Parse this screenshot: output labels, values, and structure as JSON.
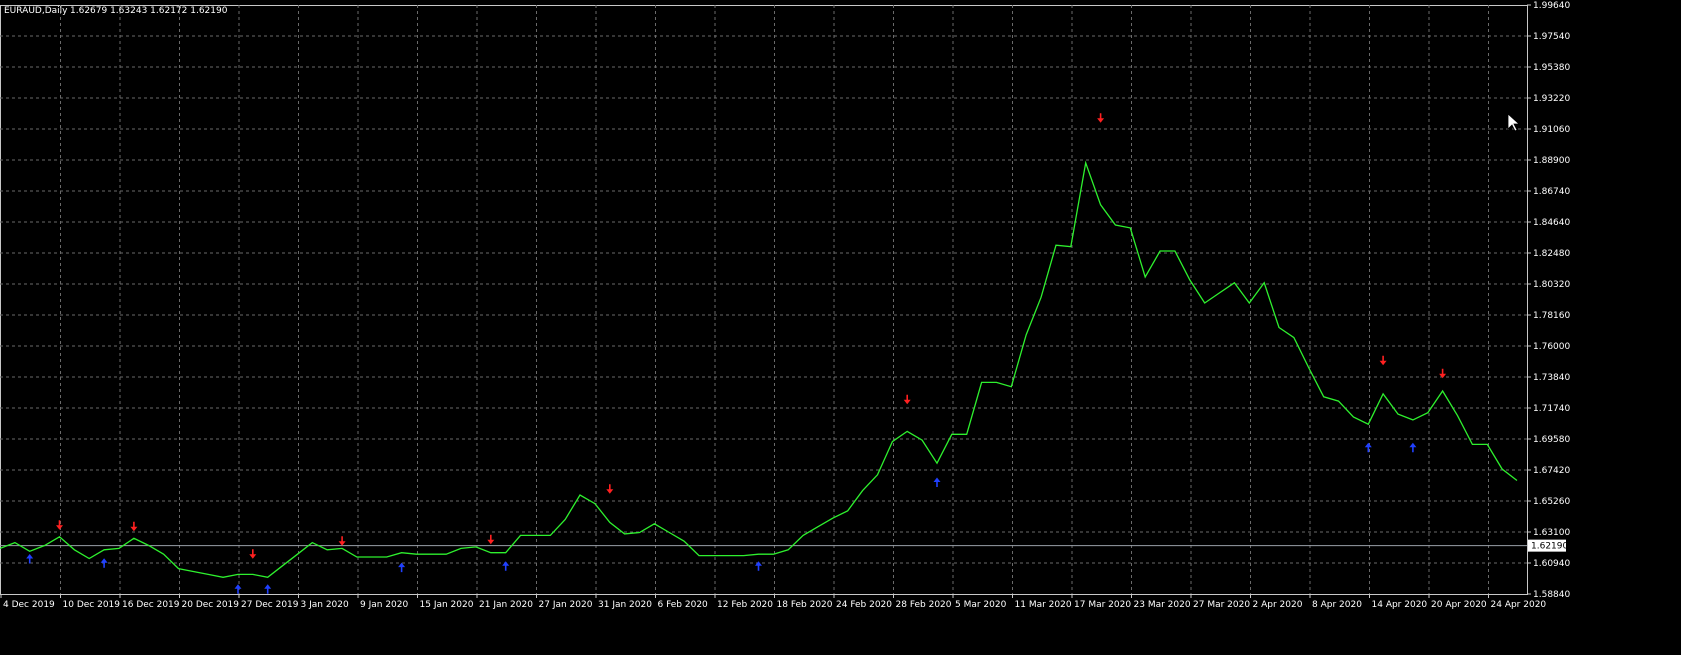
{
  "header": {
    "symbol": "EURAUD,Daily",
    "ohlc": "1.62679 1.63243 1.62172 1.62190"
  },
  "current_price_label": "1.62190",
  "colors": {
    "background": "#000000",
    "grid": "#6a6a6a",
    "line": "#2ef02e",
    "down_arrow": "#ff2020",
    "up_arrow": "#2040ff",
    "axis_text": "#ffffff",
    "price_line": "#9aa0a8"
  },
  "cursor_icon": "mouse-pointer-icon",
  "chart_data": {
    "type": "line",
    "title": "",
    "xlabel": "",
    "ylabel": "",
    "grid": true,
    "ylim": [
      1.5884,
      1.9964
    ],
    "y_ticks": [
      "1.99640",
      "1.97540",
      "1.95380",
      "1.93220",
      "1.91060",
      "1.88900",
      "1.86740",
      "1.84640",
      "1.82480",
      "1.80320",
      "1.78160",
      "1.76000",
      "1.73840",
      "1.71740",
      "1.69580",
      "1.67420",
      "1.65260",
      "1.63100",
      "1.60940",
      "1.58840"
    ],
    "x_ticks": [
      "4 Dec 2019",
      "10 Dec 2019",
      "16 Dec 2019",
      "20 Dec 2019",
      "27 Dec 2019",
      "3 Jan 2020",
      "9 Jan 2020",
      "15 Jan 2020",
      "21 Jan 2020",
      "27 Jan 2020",
      "31 Jan 2020",
      "6 Feb 2020",
      "12 Feb 2020",
      "18 Feb 2020",
      "24 Feb 2020",
      "28 Feb 2020",
      "5 Mar 2020",
      "11 Mar 2020",
      "17 Mar 2020",
      "23 Mar 2020",
      "27 Mar 2020",
      "2 Apr 2020",
      "8 Apr 2020",
      "14 Apr 2020",
      "20 Apr 2020",
      "24 Apr 2020"
    ],
    "current_price": 1.6219,
    "series": [
      {
        "values": [
          1.62,
          1.624,
          1.618,
          1.622,
          1.628,
          1.619,
          1.613,
          1.619,
          1.62,
          1.627,
          1.622,
          1.616,
          1.606,
          1.604,
          1.602,
          1.6,
          1.602,
          1.602,
          1.6,
          1.608,
          1.616,
          1.624,
          1.619,
          1.62,
          1.614,
          1.614,
          1.614,
          1.617,
          1.616,
          1.616,
          1.616,
          1.62,
          1.621,
          1.617,
          1.617,
          1.629,
          1.629,
          1.629,
          1.64,
          1.657,
          1.651,
          1.638,
          1.63,
          1.631,
          1.637,
          1.631,
          1.625,
          1.615,
          1.615,
          1.615,
          1.615,
          1.616,
          1.616,
          1.619,
          1.629,
          1.635,
          1.641,
          1.646,
          1.66,
          1.671,
          1.694,
          1.701,
          1.695,
          1.679,
          1.699,
          1.699,
          1.735,
          1.735,
          1.732,
          1.768,
          1.794,
          1.83,
          1.829,
          1.887,
          1.858,
          1.844,
          1.842,
          1.808,
          1.826,
          1.826,
          1.806,
          1.79,
          1.797,
          1.804,
          1.79,
          1.804,
          1.773,
          1.766,
          1.745,
          1.725,
          1.722,
          1.711,
          1.706,
          1.727,
          1.713,
          1.709,
          1.714,
          1.729,
          1.712,
          1.692,
          1.692,
          1.675,
          1.667
        ]
      }
    ],
    "down_arrows": [
      {
        "index": 4,
        "price": 1.636
      },
      {
        "index": 9,
        "price": 1.635
      },
      {
        "index": 17,
        "price": 1.616
      },
      {
        "index": 23,
        "price": 1.625
      },
      {
        "index": 33,
        "price": 1.626
      },
      {
        "index": 41,
        "price": 1.661
      },
      {
        "index": 61,
        "price": 1.723
      },
      {
        "index": 74,
        "price": 1.918
      },
      {
        "index": 93,
        "price": 1.75
      },
      {
        "index": 97,
        "price": 1.741
      }
    ],
    "up_arrows": [
      {
        "index": 2,
        "price": 1.613
      },
      {
        "index": 7,
        "price": 1.61
      },
      {
        "index": 16,
        "price": 1.592
      },
      {
        "index": 18,
        "price": 1.592
      },
      {
        "index": 27,
        "price": 1.607
      },
      {
        "index": 34,
        "price": 1.608
      },
      {
        "index": 51,
        "price": 1.608
      },
      {
        "index": 63,
        "price": 1.666
      },
      {
        "index": 92,
        "price": 1.69
      },
      {
        "index": 95,
        "price": 1.69
      }
    ]
  }
}
